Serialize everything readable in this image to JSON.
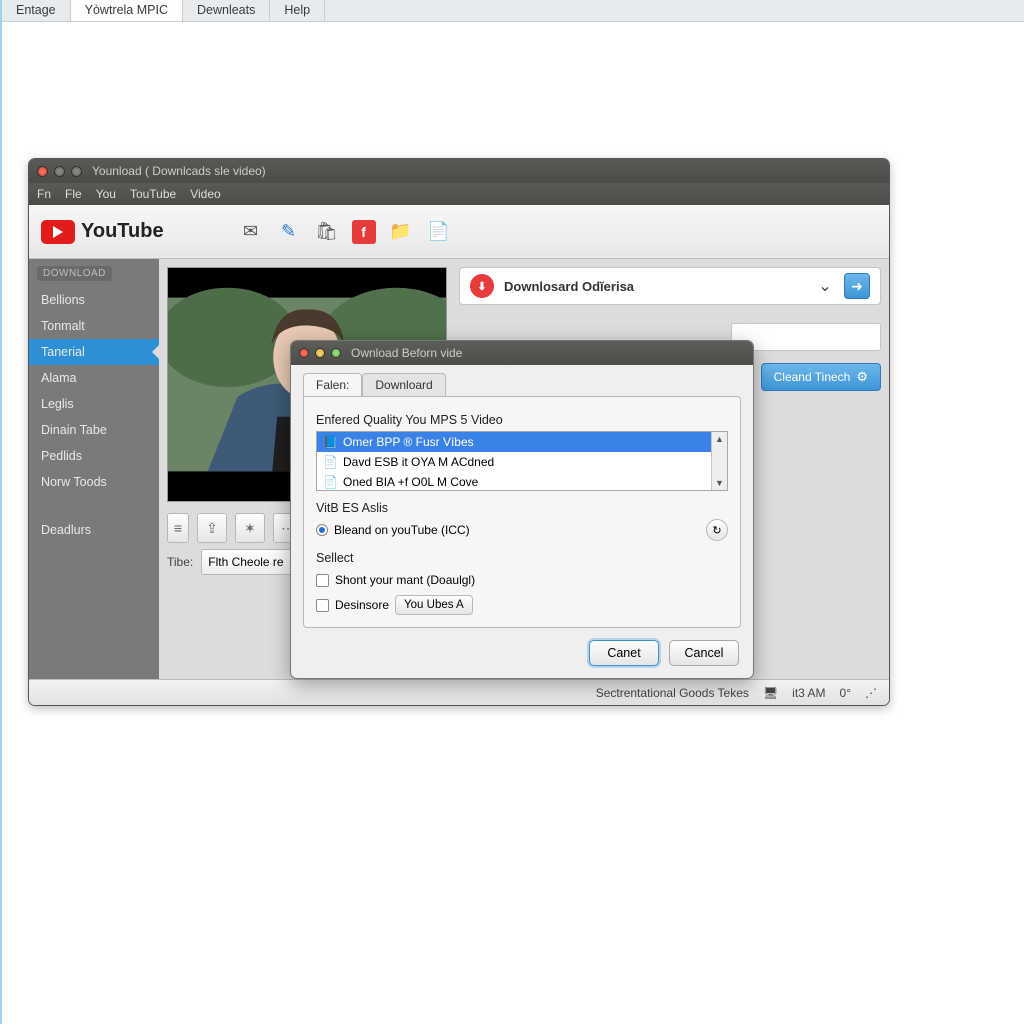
{
  "browser_tabs": [
    "Entage",
    "Yòwtrela MPIC",
    "Dewnleats",
    "Help"
  ],
  "browser_tabs_active": 1,
  "app": {
    "title": "Younload ( Downlcads sle video)",
    "menu": [
      "Fn",
      "Fle",
      "You",
      "TouTube",
      "Video"
    ],
    "youtube_label": "YouTube"
  },
  "sidebar": {
    "badge": "DOWNLOAD",
    "items": [
      "Bellions",
      "Tonmalt",
      "Tanerial",
      "Alama",
      "Leglis",
      "Dinain Tabe",
      "Pedlids",
      "Norw Toods"
    ],
    "active_index": 2,
    "footer_item": "Deadlurs"
  },
  "download_header": {
    "title": "Downlosard Odĭerisa"
  },
  "clear_button": "Cleand Tinech",
  "title_field": {
    "label": "Tibe:",
    "value": "Flth Cheole re"
  },
  "statusbar": {
    "text": "Sectrentational Goods Tekes",
    "time": "it3 AM"
  },
  "dialog": {
    "title": "Ownload Beforn vide",
    "tabs": [
      "Falen:",
      "Downloard"
    ],
    "active_tab": 0,
    "section1": "Enfered Quality You MPS 5 Video",
    "list": [
      "Omer BPP ® Fusr Víbes",
      "Davd ESB it OYA M ACdned",
      "Oned BIA +f O0L M Cove"
    ],
    "list_selected": 0,
    "section2": "VitB ES Aslis",
    "radio_label": "Bleand on youTube (ICC)",
    "section3": "Sellect",
    "check1": "Shont your mant (Doaulgl)",
    "check2": "Desinsore",
    "mini_button": "You Ubes A",
    "ok": "Canet",
    "cancel": "Cancel"
  }
}
